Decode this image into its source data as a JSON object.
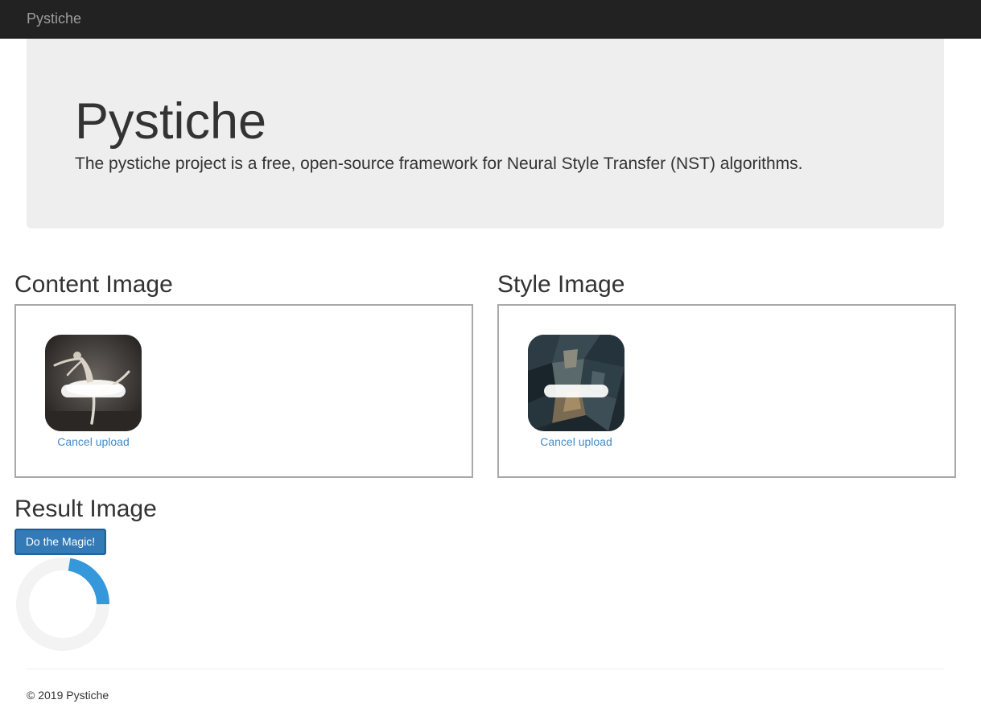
{
  "navbar": {
    "brand": "Pystiche",
    "background_color": "#222222"
  },
  "jumbotron": {
    "title": "Pystiche",
    "description": "The pystiche project is a free, open-source framework for Neural Style Transfer (NST) algorithms."
  },
  "content_image": {
    "heading": "Content Image",
    "cancel_label": "Cancel upload",
    "thumbnail_icon": "ballerina-photo-thumbnail"
  },
  "style_image": {
    "heading": "Style Image",
    "cancel_label": "Cancel upload",
    "thumbnail_icon": "cubist-painting-thumbnail"
  },
  "result_image": {
    "heading": "Result Image",
    "button_label": "Do the Magic!",
    "button_color": "#337ab7",
    "spinner_color": "#3498db"
  },
  "footer": {
    "text": "© 2019 Pystiche"
  },
  "colors": {
    "link": "#428bca",
    "jumbotron_bg": "#eeeeee"
  }
}
